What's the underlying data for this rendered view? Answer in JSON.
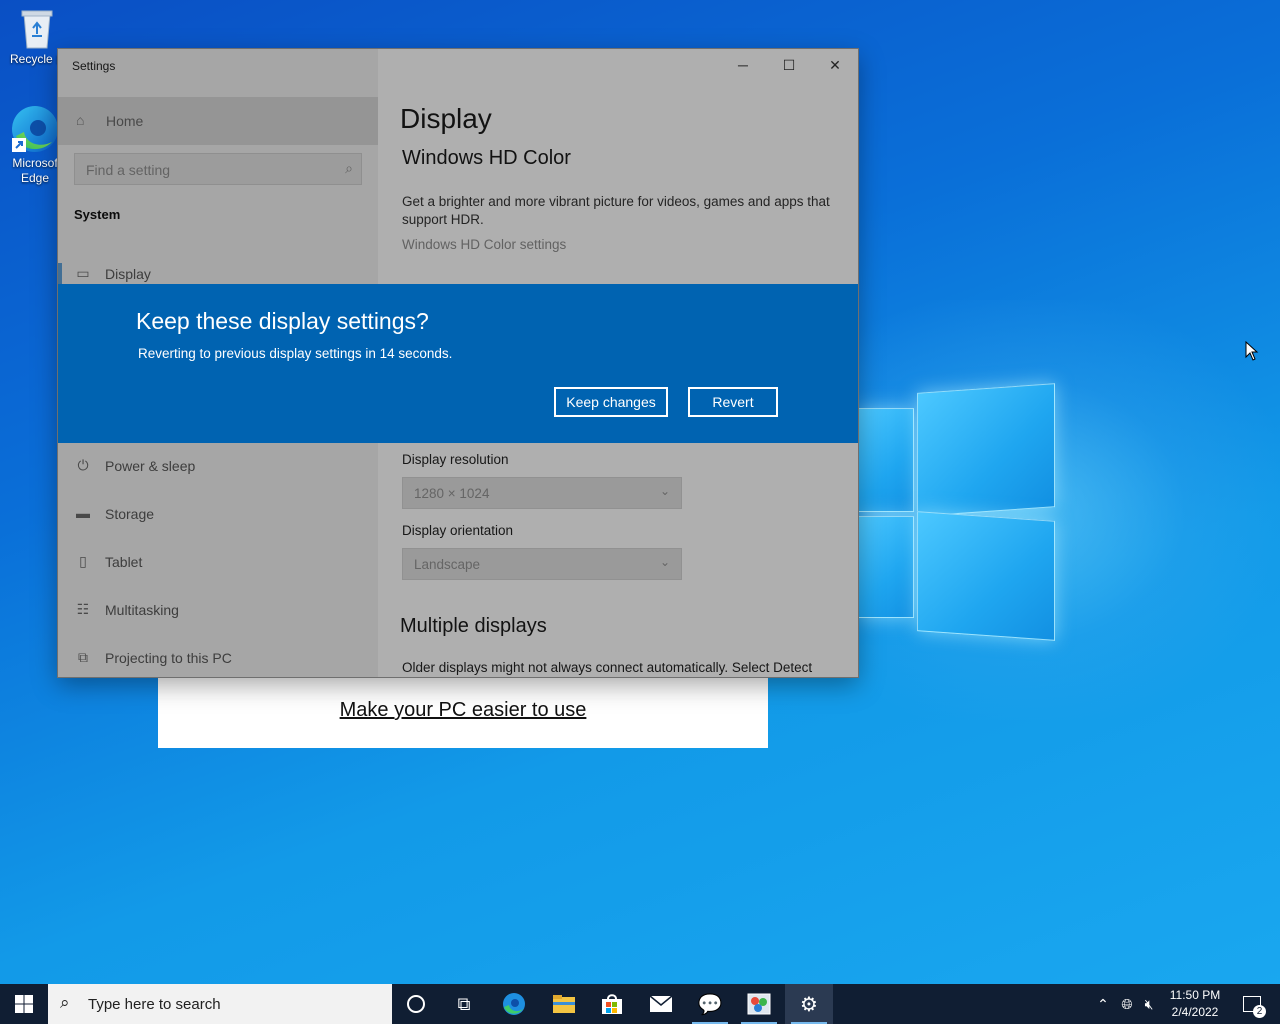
{
  "desktop": {
    "icons": [
      {
        "label": "Recycle B",
        "icon": "recycle-bin-icon"
      },
      {
        "label": "Microsoft Edge",
        "line1": "Microsof",
        "line2": "Edge",
        "icon": "edge-icon"
      }
    ],
    "ease_link": "Make your PC easier to use"
  },
  "window": {
    "title": "Settings",
    "controls": {
      "minimize": "─",
      "maximize": "☐",
      "close": "✕"
    },
    "sidebar": {
      "home": "Home",
      "search_placeholder": "Find a setting",
      "section": "System",
      "items": [
        {
          "label": "Display",
          "icon": "monitor-icon"
        },
        {
          "label": "Power & sleep",
          "icon": "power-icon"
        },
        {
          "label": "Storage",
          "icon": "storage-icon"
        },
        {
          "label": "Tablet",
          "icon": "tablet-icon"
        },
        {
          "label": "Multitasking",
          "icon": "multitasking-icon"
        },
        {
          "label": "Projecting to this PC",
          "icon": "projecting-icon"
        }
      ]
    },
    "main": {
      "page_title": "Display",
      "hdr_heading": "Windows HD Color",
      "hdr_desc": "Get a brighter and more vibrant picture for videos, games and apps that support HDR.",
      "hdr_link": "Windows HD Color settings",
      "resolution_label": "Display resolution",
      "resolution_value": "1280 × 1024",
      "orientation_label": "Display orientation",
      "orientation_value": "Landscape",
      "multi_heading": "Multiple displays",
      "multi_desc": "Older displays might not always connect automatically. Select Detect"
    }
  },
  "dialog": {
    "title": "Keep these display settings?",
    "message": "Reverting to previous display settings in 14 seconds.",
    "keep_label": "Keep changes",
    "revert_label": "Revert"
  },
  "taskbar": {
    "search_placeholder": "Type here to search",
    "apps": [
      "cortana-icon",
      "task-view-icon",
      "edge-icon",
      "file-explorer-icon",
      "store-icon",
      "mail-icon",
      "feedback-hub-icon",
      "paint-icon",
      "settings-icon"
    ],
    "time": "11:50 PM",
    "date": "2/4/2022",
    "notifications": "2"
  }
}
